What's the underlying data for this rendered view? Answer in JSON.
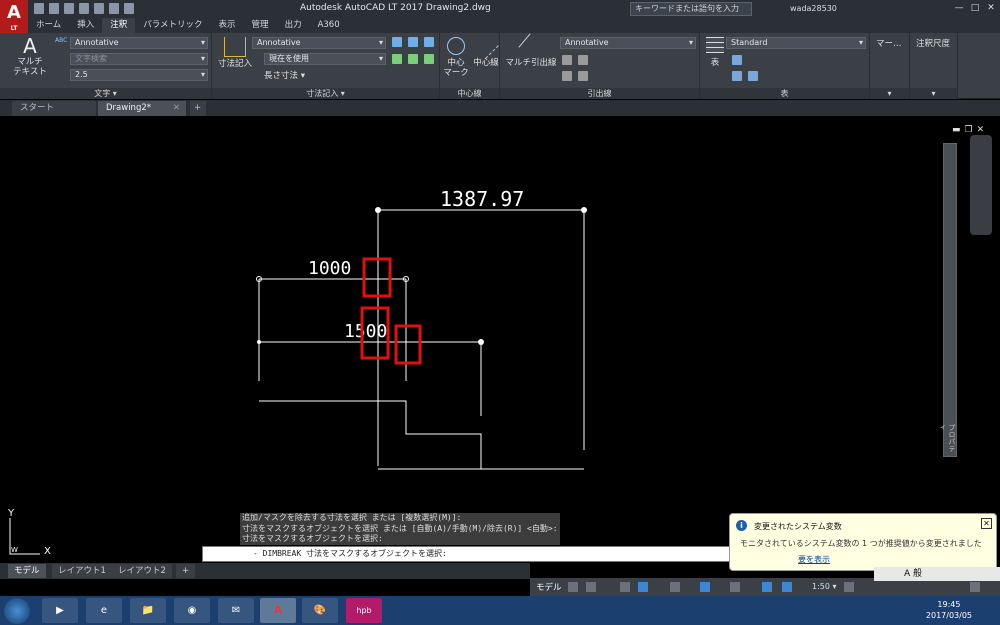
{
  "window": {
    "app_logo": "A",
    "app_logo_sub": "LT",
    "title": "Autodesk AutoCAD LT 2017    Drawing2.dwg",
    "search_placeholder": "キーワードまたは語句を入力",
    "user": "wada28530",
    "controls": [
      "—",
      "□",
      "✕"
    ]
  },
  "ribbon_tabs": [
    "ホーム",
    "挿入",
    "注釈",
    "パラメトリック",
    "表示",
    "管理",
    "出力",
    "A360"
  ],
  "active_ribbon_tab": "注釈",
  "ribbon": {
    "text_panel": {
      "label": "文字 ▾",
      "big_button": "マルチ\nテキスト",
      "style_combo": "Annotative",
      "find_placeholder": "文字検索",
      "height_combo": "2.5",
      "icon_abc": "ABC"
    },
    "dim_panel": {
      "label": "寸法記入 ▾",
      "big_button": "寸法記入",
      "style_combo": "Annotative",
      "layer_combo": "現在を使用",
      "linear": "長さ寸法 ▾"
    },
    "centerline_panel": {
      "label": "中心線",
      "center_mark": "中心\nマーク",
      "centerline": "中心線"
    },
    "leader_panel": {
      "label": "引出線",
      "multileader": "マルチ引出線",
      "style_combo": "Annotative"
    },
    "table_panel": {
      "label": "表",
      "table": "表",
      "style_combo": "Standard"
    },
    "markup_panel": {
      "label": "マー…"
    },
    "scale_panel": {
      "label": "注釈尺度"
    }
  },
  "doc_tabs": {
    "start": "スタート",
    "drawing": "Drawing2*",
    "close_glyph": "✕",
    "new_glyph": "+"
  },
  "drawing": {
    "dim_top": "1387.97",
    "dim_left": "1000",
    "dim_mid": "1500",
    "ucs_y": "Y",
    "ucs_x": "X",
    "ucs_w": "W"
  },
  "viewport": {
    "controls": [
      "▬",
      "❐",
      "✕"
    ],
    "palette_label": "プロパティ"
  },
  "command": {
    "history": [
      "追加/マスクを除去する寸法を選択 または [複数選択(M)]:",
      "寸法をマスクするオブジェクトを選択 または [自動(A)/手動(M)/除去(R)] <自動>:",
      "寸法をマスクするオブジェクトを選択:"
    ],
    "current": "- DIMBREAK 寸法をマスクするオブジェクトを選択:",
    "left_icons": "✕ 🔧"
  },
  "notification": {
    "title": "変更されたシステム変数",
    "message": "モニタされているシステム変数の 1 つが推奨値から変更されました",
    "link": "要を表示",
    "close": "✕",
    "info": "i"
  },
  "layout_tabs": [
    "モデル",
    "レイアウト1",
    "レイアウト2"
  ],
  "layout_add": "+",
  "status": {
    "model": "モデル",
    "scale": "1:50 ▾"
  },
  "ime": {
    "text": "A 般"
  },
  "taskbar": {
    "apps": [
      "▶",
      "e",
      "📁",
      "◉",
      "✉",
      "A",
      "🎨",
      "hpb"
    ],
    "time": "19:45",
    "date": "2017/03/05"
  },
  "colors": {
    "background": "#000000",
    "ribbon": "#3b4047",
    "highlight_box": "#e01010",
    "app_red": "#b31b1b"
  }
}
